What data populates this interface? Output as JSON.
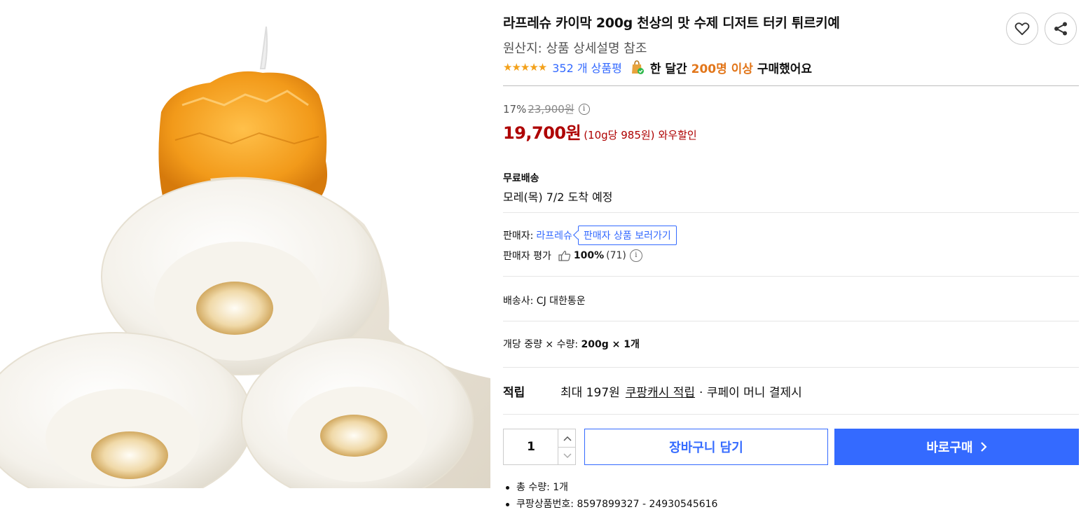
{
  "product": {
    "title": "라프레슈 카이막 200g 천상의 맛 수제 디저트 터키 튀르키예",
    "origin": "원산지: 상품 상세설명 참조",
    "image_alt": "카이막 제품 사진"
  },
  "rating": {
    "stars_icon": "star-rating-icon",
    "stars": 5,
    "review_count": "352 개 상품평",
    "bought_prefix": "한 달간 ",
    "bought_highlight": "200명 이상",
    "bought_suffix": " 구매했어요"
  },
  "actions": {
    "favorite_icon": "heart-icon",
    "share_icon": "share-icon"
  },
  "price": {
    "discount_rate": "17%",
    "original_price": "23,900원",
    "sale_price": "19,700원",
    "unit_price": "(10g당 985원)",
    "wow_label": "와우할인"
  },
  "shipping": {
    "label": "무료배송",
    "arrival": "모레(목) 7/2 도착 예정"
  },
  "seller": {
    "label": "판매자:",
    "name": "라프레슈",
    "view_products": "판매자 상품 보러가기",
    "rating_label": "판매자 평가",
    "rating_percent": "100%",
    "rating_count": "(71)"
  },
  "carrier": {
    "text": "배송사:  CJ 대한통운"
  },
  "weight": {
    "label": "개당 중량 × 수량: ",
    "value": "200g × 1개"
  },
  "cash": {
    "label": "적립",
    "amount": "최대 197원",
    "link": "쿠팡캐시 적립",
    "desc": "· 쿠페이 머니 결제시"
  },
  "purchase": {
    "quantity": "1",
    "cart_label": "장바구니 담기",
    "buy_label": "바로구매"
  },
  "details": [
    "총 수량: 1개",
    "쿠팡상품번호: 8597899327 - 24930545616"
  ],
  "colors": {
    "accent": "#346aff",
    "price": "#ae0000",
    "star": "#f3a11b",
    "highlight": "#e2761a"
  }
}
